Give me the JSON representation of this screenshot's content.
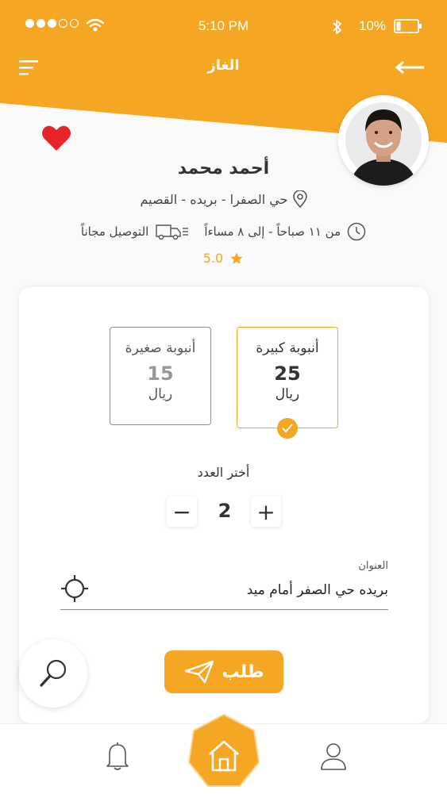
{
  "colors": {
    "accent": "#f5a623",
    "heart": "#e8232a",
    "background": "#f9f9f9"
  },
  "status_bar": {
    "time": "5:10 PM",
    "battery": "10%",
    "signal_icon": "signal-dots-icon",
    "wifi_icon": "wifi-icon",
    "bluetooth_icon": "bluetooth-icon",
    "battery_icon": "battery-icon"
  },
  "header": {
    "title": "الغاز",
    "menu_icon": "menu-icon",
    "back_icon": "back-arrow-icon"
  },
  "vendor": {
    "name": "أحمد محمد",
    "location": "حي الصفرا - بريده - القصيم",
    "hours": "من ١١ صباحاً - إلى ٨ مساءاً",
    "delivery": "التوصيل مجاناً",
    "rating": "5.0",
    "favorite": true
  },
  "options": [
    {
      "name": "أنبوبة كبيرة",
      "price": "25",
      "currency": "ريال",
      "selected": true
    },
    {
      "name": "أنبوبة صغيرة",
      "price": "15",
      "currency": "ريال",
      "selected": false
    }
  ],
  "quantity": {
    "label": "أختر العدد",
    "value": "2",
    "minus": "−",
    "plus": "+"
  },
  "address": {
    "label": "العنوان",
    "value": "بريده حي الصفر أمام ميد"
  },
  "order_button": {
    "label": "طلب"
  },
  "bottom_nav": {
    "items": [
      "bell-icon",
      "home-icon",
      "user-icon"
    ],
    "active": "home-icon"
  }
}
